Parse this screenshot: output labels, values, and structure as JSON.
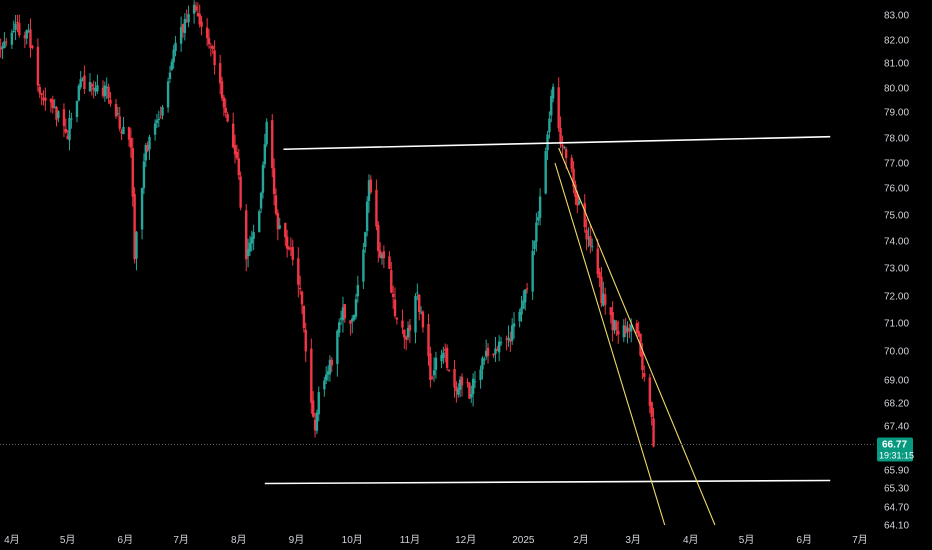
{
  "chart_data": {
    "type": "candlestick",
    "title": "",
    "y_axis": {
      "side": "right",
      "ticks": [
        "83.00",
        "82.00",
        "81.00",
        "80.00",
        "79.00",
        "78.00",
        "77.00",
        "76.00",
        "75.00",
        "74.00",
        "73.00",
        "72.00",
        "71.00",
        "70.00",
        "69.00",
        "68.20",
        "67.40",
        "65.90",
        "65.30",
        "64.70",
        "64.10"
      ],
      "range": [
        63.9,
        83.5
      ]
    },
    "x_axis": {
      "ticks": [
        "4月",
        "5月",
        "6月",
        "7月",
        "8月",
        "9月",
        "10月",
        "11月",
        "12月",
        "2025",
        "2月",
        "3月",
        "4月",
        "5月",
        "6月",
        "7月"
      ]
    },
    "last_price": {
      "value": "66.77",
      "countdown": "19:31:15",
      "color": "#089981"
    },
    "colors": {
      "up": "#26a69a",
      "down": "#f23645",
      "background": "#000000",
      "trendline": "#ffffff",
      "wedge": "#f0d96a"
    },
    "grid": false,
    "legend": "none",
    "drawings": [
      {
        "name": "resistance-line",
        "color": "#ffffff",
        "from": [
          "2024-08-25",
          77.55
        ],
        "to": [
          "2025-06-15",
          78.05
        ]
      },
      {
        "name": "support-line",
        "color": "#ffffff",
        "from": [
          "2024-08-15",
          65.45
        ],
        "to": [
          "2025-06-15",
          65.55
        ]
      },
      {
        "name": "wedge-lower-line",
        "color": "#f0d96a",
        "from": [
          "2025-01-18",
          77.0
        ],
        "to": [
          "2025-03-18",
          64.1
        ]
      },
      {
        "name": "wedge-upper-line",
        "color": "#f0d96a",
        "from": [
          "2025-01-20",
          77.6
        ],
        "to": [
          "2025-04-14",
          64.1
        ]
      }
    ],
    "series": [
      {
        "key_points": [
          [
            "2024-03-26",
            81.8
          ],
          [
            "2024-04-02",
            82.6
          ],
          [
            "2024-04-10",
            82.2
          ],
          [
            "2024-04-17",
            79.5
          ],
          [
            "2024-04-24",
            79.0
          ],
          [
            "2024-05-01",
            78.2
          ],
          [
            "2024-05-08",
            80.3
          ],
          [
            "2024-05-15",
            80.0
          ],
          [
            "2024-05-22",
            79.8
          ],
          [
            "2024-05-28",
            78.7
          ],
          [
            "2024-06-04",
            77.5
          ],
          [
            "2024-06-06",
            73.5
          ],
          [
            "2024-06-12",
            77.6
          ],
          [
            "2024-06-20",
            78.8
          ],
          [
            "2024-06-26",
            81.2
          ],
          [
            "2024-07-03",
            82.7
          ],
          [
            "2024-07-08",
            83.3
          ],
          [
            "2024-07-12",
            82.5
          ],
          [
            "2024-07-18",
            81.5
          ],
          [
            "2024-07-25",
            79.0
          ],
          [
            "2024-07-31",
            77.0
          ],
          [
            "2024-08-05",
            73.3
          ],
          [
            "2024-08-12",
            75.0
          ],
          [
            "2024-08-16",
            78.6
          ],
          [
            "2024-08-22",
            74.5
          ],
          [
            "2024-08-28",
            73.8
          ],
          [
            "2024-09-03",
            72.2
          ],
          [
            "2024-09-08",
            68.5
          ],
          [
            "2024-09-11",
            67.0
          ],
          [
            "2024-09-13",
            68.7
          ],
          [
            "2024-09-20",
            69.7
          ],
          [
            "2024-09-26",
            71.4
          ],
          [
            "2024-10-01",
            70.9
          ],
          [
            "2024-10-04",
            72.2
          ],
          [
            "2024-10-08",
            74.5
          ],
          [
            "2024-10-10",
            76.5
          ],
          [
            "2024-10-15",
            73.8
          ],
          [
            "2024-10-21",
            72.8
          ],
          [
            "2024-10-25",
            71.0
          ],
          [
            "2024-10-30",
            70.5
          ],
          [
            "2024-11-05",
            72.0
          ],
          [
            "2024-11-12",
            69.2
          ],
          [
            "2024-11-19",
            70.0
          ],
          [
            "2024-11-26",
            68.8
          ],
          [
            "2024-12-03",
            68.6
          ],
          [
            "2024-12-10",
            69.6
          ],
          [
            "2024-12-17",
            70.2
          ],
          [
            "2024-12-24",
            70.3
          ],
          [
            "2024-12-31",
            71.5
          ],
          [
            "2025-01-06",
            73.4
          ],
          [
            "2025-01-10",
            75.7
          ],
          [
            "2025-01-15",
            78.9
          ],
          [
            "2025-01-17",
            80.1
          ],
          [
            "2025-01-21",
            77.8
          ],
          [
            "2025-01-27",
            76.5
          ],
          [
            "2025-02-03",
            74.4
          ],
          [
            "2025-02-07",
            73.8
          ],
          [
            "2025-02-12",
            72.0
          ],
          [
            "2025-02-17",
            71.2
          ],
          [
            "2025-02-21",
            70.5
          ],
          [
            "2025-02-26",
            71.0
          ],
          [
            "2025-03-03",
            70.8
          ],
          [
            "2025-03-06",
            69.6
          ],
          [
            "2025-03-10",
            68.3
          ],
          [
            "2025-03-12",
            66.77
          ]
        ]
      }
    ]
  }
}
